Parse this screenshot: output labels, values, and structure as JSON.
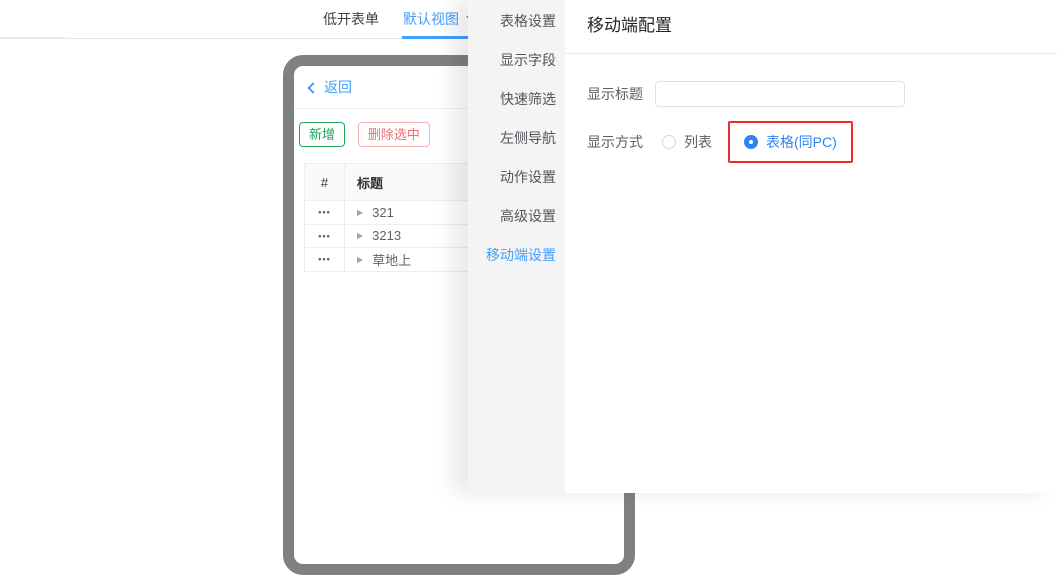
{
  "topbar": {
    "tabs": [
      {
        "label": "低开表单",
        "active": false
      },
      {
        "label": "默认视图",
        "active": true,
        "has_dropdown": true
      }
    ]
  },
  "phone_preview": {
    "back_label": "返回",
    "buttons": {
      "add": "新增",
      "delete_selected": "删除选中"
    },
    "table": {
      "columns": [
        "#",
        "标题"
      ],
      "rows": [
        "321",
        "3213",
        "草地上"
      ]
    }
  },
  "drawer": {
    "menu": {
      "items": [
        "表格设置",
        "显示字段",
        "快速筛选",
        "左侧导航",
        "动作设置",
        "高级设置",
        "移动端设置"
      ],
      "active_item": "移动端设置"
    },
    "panel": {
      "title": "移动端配置",
      "fields": {
        "display_title": {
          "label": "显示标题",
          "value": "",
          "placeholder": ""
        },
        "display_mode": {
          "label": "显示方式",
          "options": [
            {
              "label": "列表",
              "selected": false
            },
            {
              "label": "表格(同PC)",
              "selected": true,
              "highlighted_red_box": true
            }
          ]
        }
      }
    }
  },
  "icons": {
    "back_chevron": "‹",
    "tab_caret": "▼",
    "row_expand": "▶",
    "row_actions": "•••"
  },
  "colors": {
    "accent_blue": "#409eff",
    "radio_selected_blue": "#2e83f3",
    "highlight_red": "#f02b2b",
    "add_green": "#26a35a",
    "delete_red": "#f56c6c",
    "phone_frame_gray": "#7f8082",
    "menu_bg": "#f4f4f5",
    "table_border": "#ebeef5"
  }
}
